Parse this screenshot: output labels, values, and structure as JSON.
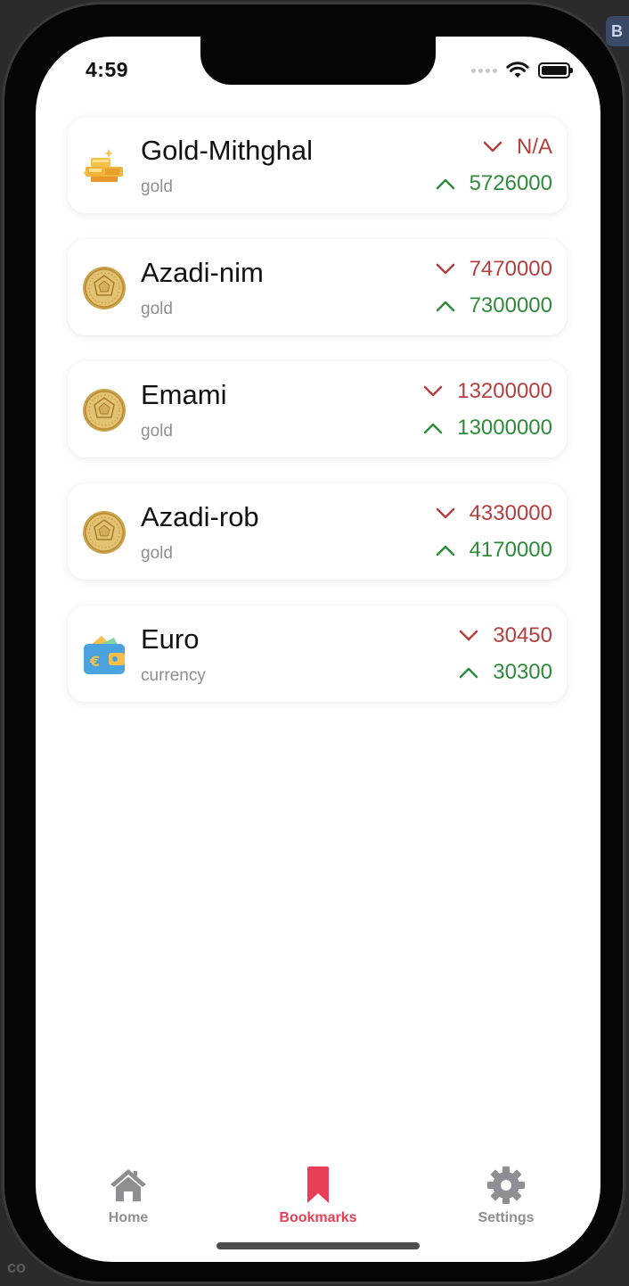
{
  "status": {
    "time": "4:59"
  },
  "items": [
    {
      "title": "Gold-Mithghal",
      "category": "gold",
      "icon": "gold-bars-icon",
      "sell": "N/A",
      "buy": "5726000"
    },
    {
      "title": "Azadi-nim",
      "category": "gold",
      "icon": "gold-coin-icon",
      "sell": "7470000",
      "buy": "7300000"
    },
    {
      "title": "Emami",
      "category": "gold",
      "icon": "gold-coin-icon",
      "sell": "13200000",
      "buy": "13000000"
    },
    {
      "title": "Azadi-rob",
      "category": "gold",
      "icon": "gold-coin-icon",
      "sell": "4330000",
      "buy": "4170000"
    },
    {
      "title": "Euro",
      "category": "currency",
      "icon": "euro-wallet-icon",
      "sell": "30450",
      "buy": "30300"
    }
  ],
  "tabs": [
    {
      "label": "Home",
      "icon": "house-icon",
      "active": false
    },
    {
      "label": "Bookmarks",
      "icon": "bookmark-icon",
      "active": true
    },
    {
      "label": "Settings",
      "icon": "gear-icon",
      "active": false
    }
  ],
  "colors": {
    "sell": "#b2403f",
    "buy": "#2f8a3b",
    "accent": "#e83f56",
    "inactive_tab": "#8e8e93"
  }
}
